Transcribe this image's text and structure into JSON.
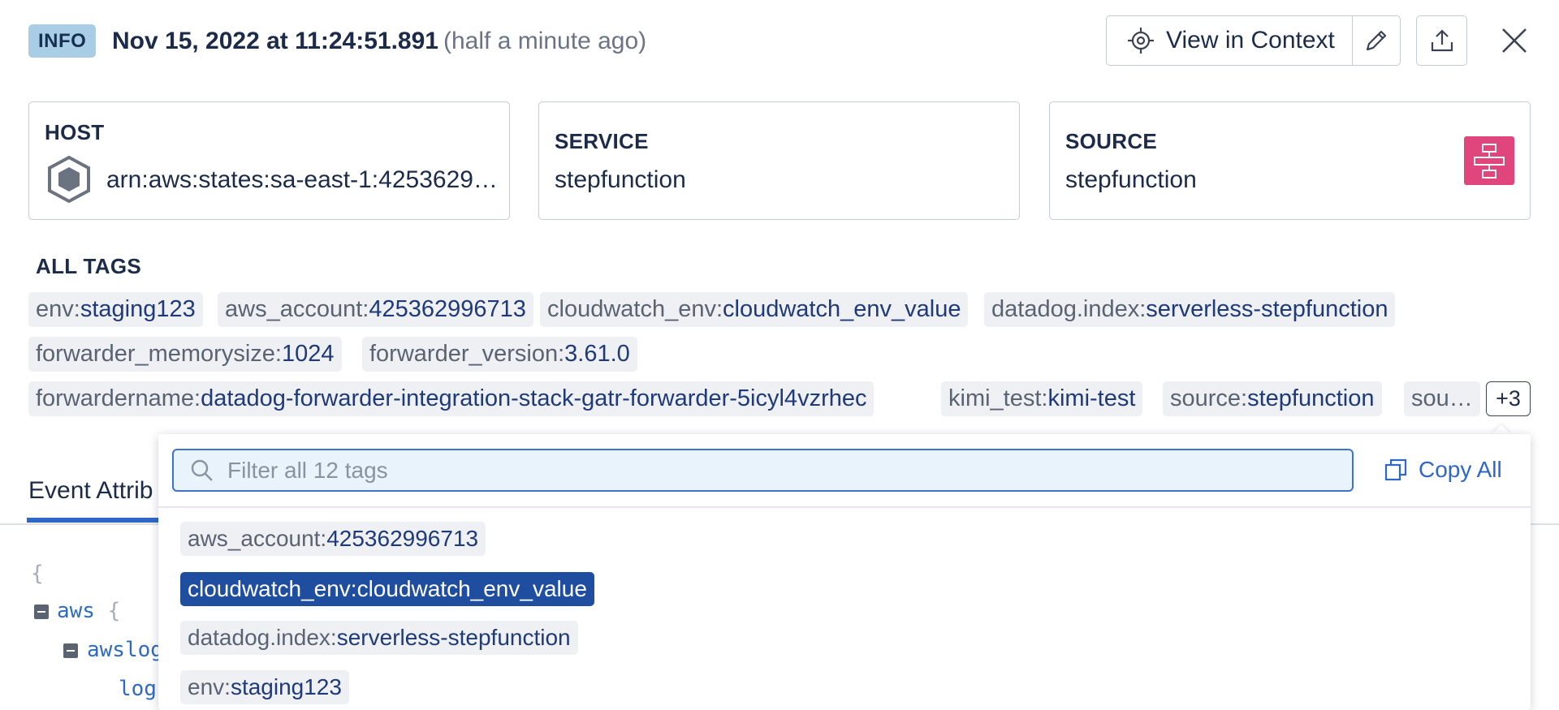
{
  "header": {
    "level": "INFO",
    "timestamp": "Nov 15, 2022 at 11:24:51.891",
    "relative_time": "(half a minute ago)",
    "view_in_context_label": "View in Context"
  },
  "cards": {
    "host": {
      "label": "HOST",
      "value": "arn:aws:states:sa-east-1:4253629…"
    },
    "service": {
      "label": "SERVICE",
      "value": "stepfunction"
    },
    "source": {
      "label": "SOURCE",
      "value": "stepfunction"
    }
  },
  "tags": {
    "title": "ALL TAGS",
    "items": [
      {
        "key": "env:",
        "value": "staging123"
      },
      {
        "key": "aws_account:",
        "value": "425362996713"
      },
      {
        "key": "cloudwatch_env:",
        "value": "cloudwatch_env_value"
      },
      {
        "key": "datadog.index:",
        "value": "serverless-stepfunction"
      },
      {
        "key": "forwarder_memorysize:",
        "value": "1024"
      },
      {
        "key": "forwarder_version:",
        "value": "3.61.0"
      },
      {
        "key": "forwardername:",
        "value": "datadog-forwarder-integration-stack-gatr-forwarder-5icyl4vzrhec"
      },
      {
        "key": "kimi_test:",
        "value": "kimi-test"
      },
      {
        "key": "source:",
        "value": "stepfunction"
      },
      {
        "key": "sou…",
        "value": ""
      }
    ],
    "more_label": "+3"
  },
  "tabs": {
    "event_attributes": "Event Attrib"
  },
  "json_view": {
    "open_brace": "{",
    "line1_key": "aws",
    "line1_punc": " {",
    "line2_key": "awslog",
    "line3_key": "log"
  },
  "popover": {
    "filter_placeholder": "Filter all 12 tags",
    "copy_all_label": "Copy All",
    "items": [
      {
        "key": "aws_account:",
        "value": "425362996713",
        "selected": false
      },
      {
        "key": "cloudwatch_env:",
        "value": "cloudwatch_env_value",
        "selected": true
      },
      {
        "key": "datadog.index:",
        "value": "serverless-stepfunction",
        "selected": false
      },
      {
        "key": "env:",
        "value": "staging123",
        "selected": false
      }
    ]
  },
  "colors": {
    "accent": "#2f67c8",
    "selected_tag": "#1f4ea0",
    "source_icon_bg": "#e0457b",
    "info_badge": "#a9cde5"
  },
  "icons": {
    "view_in_context": "crosshair-icon",
    "edit": "pencil-icon",
    "share": "upload-icon",
    "close": "close-icon",
    "host": "hexagon-icon",
    "source": "step-functions-icon",
    "search": "search-icon",
    "copy": "copy-icon"
  }
}
